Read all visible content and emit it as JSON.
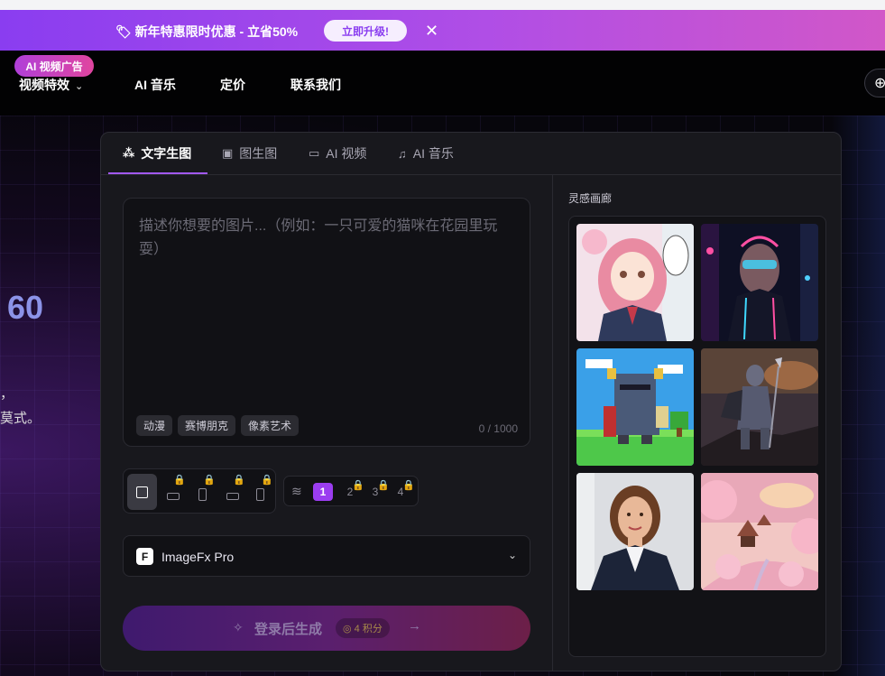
{
  "promo": {
    "icon": "sale-icon",
    "text": "新年特惠限时优惠 - 立省50%",
    "button": "立即升级!",
    "close": "✕"
  },
  "nav": {
    "badge": "AI 视频广告",
    "items": [
      "视频特效",
      "AI 音乐",
      "定价",
      "联系我们"
    ],
    "dropdown_glyph": "⌄",
    "globe": "⊕"
  },
  "hero": {
    "number": "60",
    "line1": "，",
    "line2": "莫式。"
  },
  "tabs": [
    {
      "label": "文字生图",
      "icon": "magic-wand-icon",
      "glyph": "⁂",
      "active": true
    },
    {
      "label": "图生图",
      "icon": "image-icon",
      "glyph": "▣",
      "active": false
    },
    {
      "label": "AI 视频",
      "icon": "video-icon",
      "glyph": "▭",
      "active": false
    },
    {
      "label": "AI 音乐",
      "icon": "music-icon",
      "glyph": "♫",
      "active": false
    }
  ],
  "prompt": {
    "placeholder": "描述你想要的图片...（例如：一只可爱的猫咪在花园里玩耍）",
    "value": "",
    "chips": [
      "动漫",
      "赛博朋克",
      "像素艺术"
    ],
    "counter": "0 / 1000"
  },
  "ratios": [
    {
      "shape": "square",
      "locked": false,
      "active": true
    },
    {
      "shape": "landscape",
      "locked": true,
      "active": false
    },
    {
      "shape": "portrait",
      "locked": true,
      "active": false
    },
    {
      "shape": "landscape-wide",
      "locked": true,
      "active": false
    },
    {
      "shape": "portrait-tall",
      "locked": true,
      "active": false
    }
  ],
  "count": {
    "icon": "layers-icon",
    "options": [
      "1",
      "2",
      "3",
      "4"
    ],
    "selected": "1"
  },
  "model": {
    "logo": "F",
    "name": "ImageFx Pro",
    "chevron": "⌄"
  },
  "generate": {
    "icon": "sparkle-icon",
    "label": "登录后生成",
    "cost": "4 积分",
    "arrow": "→"
  },
  "gallery": {
    "title": "灵感画廊",
    "images": [
      "anime-schoolgirl",
      "cyberpunk-woman",
      "pixel-knight",
      "armored-warrior",
      "business-portrait",
      "sakura-landscape"
    ]
  },
  "colors": {
    "accent": "#a259f5",
    "promo_start": "#8a3df0",
    "promo_end": "#d157c8",
    "lock": "#f5b043"
  }
}
